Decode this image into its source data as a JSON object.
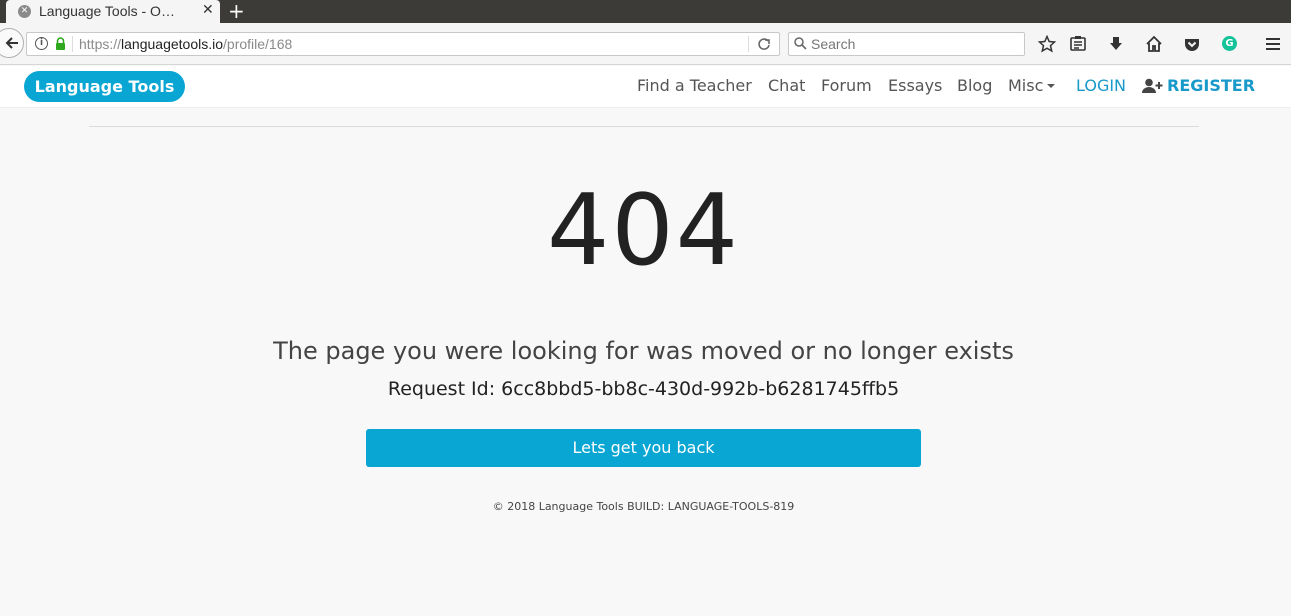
{
  "browser": {
    "tab_title": "Language Tools - O…",
    "close_glyph": "✕",
    "new_tab_glyph": "+",
    "url_prefix": "https://",
    "url_host": "languagetools.io",
    "url_path": "/profile/168",
    "search_placeholder": "Search"
  },
  "site": {
    "brand": "Language Tools",
    "nav": {
      "find_teacher": "Find a Teacher",
      "chat": "Chat",
      "forum": "Forum",
      "essays": "Essays",
      "blog": "Blog",
      "misc": "Misc",
      "login": "LOGIN",
      "register": "REGISTER"
    },
    "accent_color": "#0aa6d3"
  },
  "error": {
    "code": "404",
    "message": "The page you were looking for was moved or no longer exists",
    "request_id": "Request Id: 6cc8bbd5-bb8c-430d-992b-b6281745ffb5",
    "back_label": "Lets get you back"
  },
  "footer": {
    "text": "© 2018 Language Tools BUILD: LANGUAGE-TOOLS-819"
  },
  "icons": {
    "toolbar": [
      "star-icon",
      "reading-list-icon",
      "download-icon",
      "home-icon",
      "pocket-icon",
      "grammarly-icon",
      "menu-icon"
    ]
  }
}
